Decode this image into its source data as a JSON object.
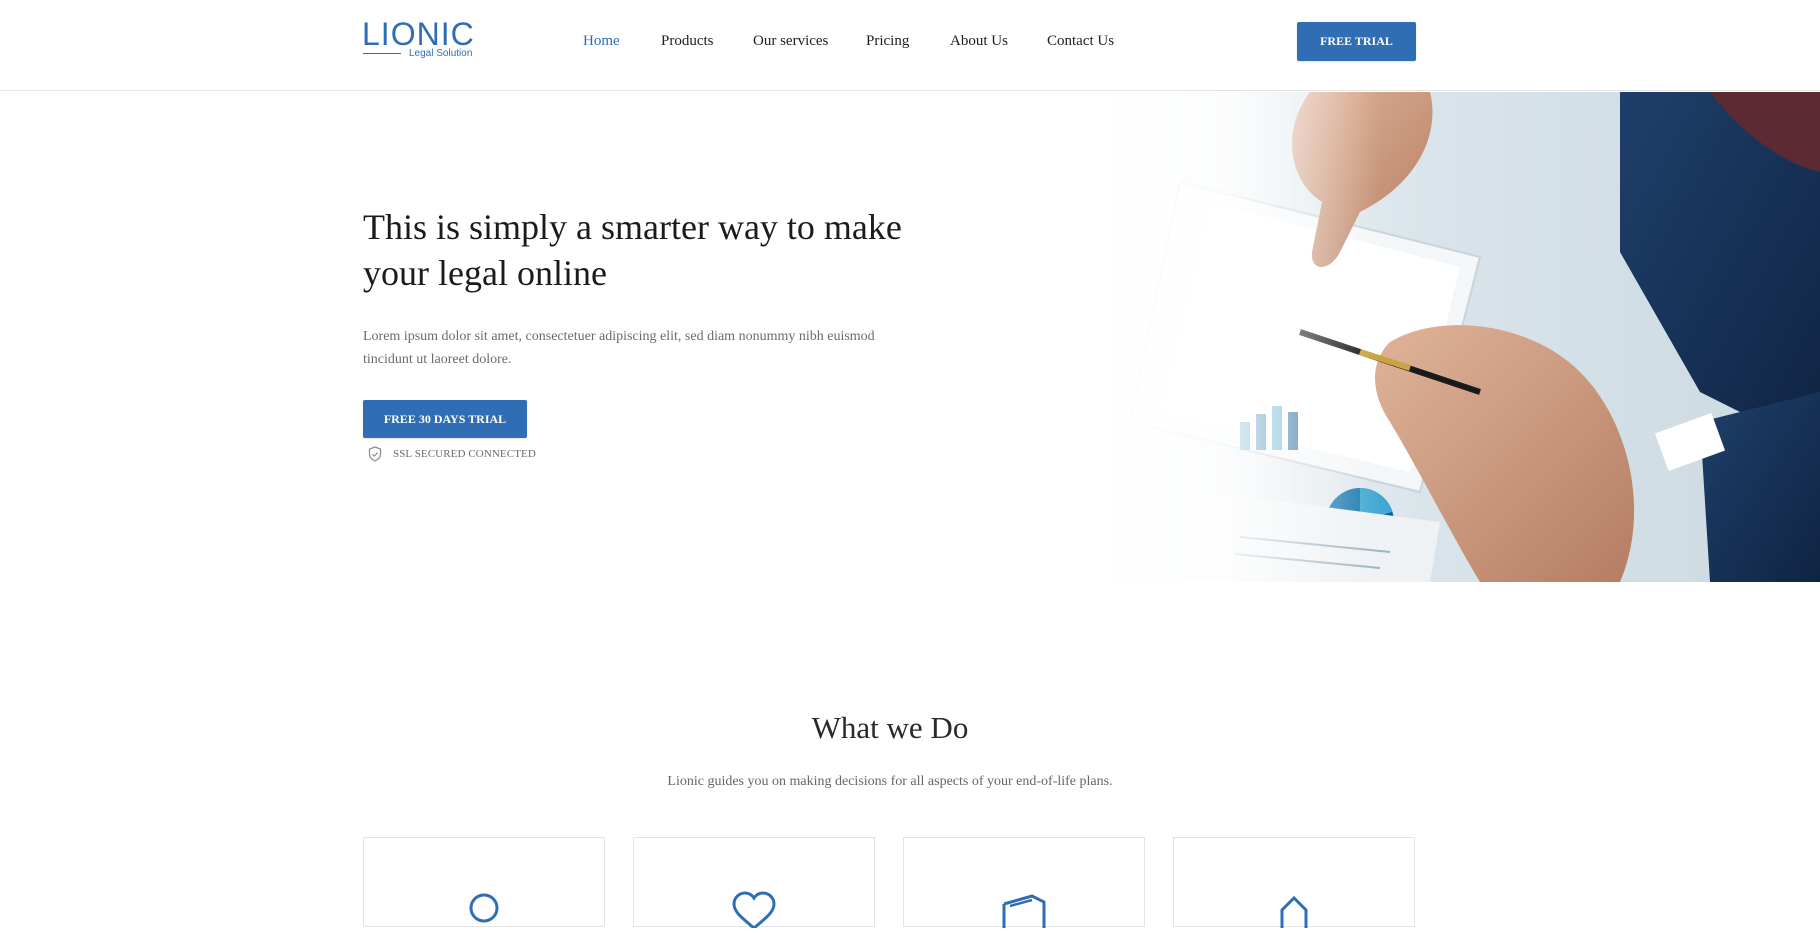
{
  "header": {
    "logo": {
      "main": "LIONIC",
      "sub": "Legal Solution"
    },
    "nav": [
      "Home",
      "Products",
      "Our services",
      "Pricing",
      "About Us",
      "Contact Us"
    ],
    "active_nav": "Home",
    "cta_label": "FREE TRIAL"
  },
  "hero": {
    "title": "This is simply a smarter way to make your legal online",
    "description": "Lorem ipsum dolor sit amet, consectetuer adipiscing elit, sed diam nonummy nibh euismod tincidunt ut laoreet dolore.",
    "cta_label": "FREE 30 DAYS TRIAL",
    "ssl_label": "SSL SECURED CONNECTED",
    "image_icon": "business-meeting-photo"
  },
  "what_we_do": {
    "title": "What we Do",
    "subtitle": "Lionic guides you on making decisions for all aspects of your end-of-life plans.",
    "cards": [
      {
        "icon": "person-icon"
      },
      {
        "icon": "heart-icon"
      },
      {
        "icon": "document-icon"
      },
      {
        "icon": "house-icon"
      }
    ]
  },
  "colors": {
    "accent": "#2f6db5",
    "text_dark": "#1b1b1b",
    "text_muted": "#6b6b6b",
    "border": "#e4e4e4"
  }
}
